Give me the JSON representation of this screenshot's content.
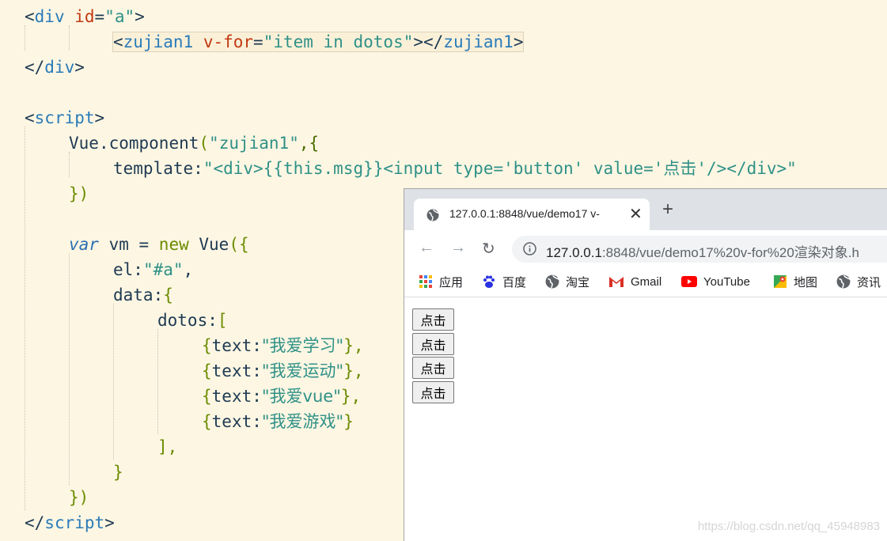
{
  "code": {
    "div_open": {
      "lt": "<",
      "tag": "div",
      "attr": "id",
      "eq": "=",
      "val": "\"a\"",
      "gt": ">"
    },
    "comp_line": {
      "lt": "<",
      "tag": "zujian1",
      "attr": "v-for",
      "eq": "=",
      "val": "\"item in dotos\"",
      "mid": "></",
      "tag2": "zujian1",
      "gt": ">"
    },
    "div_close": {
      "lt": "</",
      "tag": "div",
      "gt": ">"
    },
    "script_open": {
      "lt": "<",
      "tag": "script",
      "gt": ">"
    },
    "vue_component": {
      "obj": "Vue",
      "dot": ".",
      "fn": "component",
      "open": "(",
      "str": "\"zujian1\"",
      "rest": ",{"
    },
    "template_line": {
      "key": "template",
      "colon": ":",
      "str": "\"<div>{{this.msg}}<input type='button' value='点击'/></div>\""
    },
    "comp_close": "})",
    "var_line": {
      "kw": "var",
      "rest": " vm = ",
      "new": "new",
      "ctor": " Vue",
      "open": "({"
    },
    "el_line": {
      "key": "el",
      "colon": ":",
      "str": "\"#a\"",
      "comma": ","
    },
    "data_line": {
      "key": "data",
      "colon": ":",
      "brace": "{"
    },
    "dotos_line": {
      "key": "dotos",
      "colon": ":",
      "bracket": "["
    },
    "items": [
      {
        "open": "{",
        "key": "text",
        "colon": ":",
        "str": "\"我爱学习\"",
        "close": "},"
      },
      {
        "open": "{",
        "key": "text",
        "colon": ":",
        "str": "\"我爱运动\"",
        "close": "},"
      },
      {
        "open": "{",
        "key": "text",
        "colon": ":",
        "str": "\"我爱vue\"",
        "close": "},"
      },
      {
        "open": "{",
        "key": "text",
        "colon": ":",
        "str": "\"我爱游戏\"",
        "close": "}"
      }
    ],
    "bracket_close": "],",
    "brace_close": "}",
    "vm_close": "})",
    "script_close": {
      "lt": "</",
      "tag": "script",
      "gt": ">"
    }
  },
  "browser": {
    "tab_title": "127.0.0.1:8848/vue/demo17 v-",
    "tab_icon": "globe-icon",
    "url_host": "127.0.0.1",
    "url_path": ":8848/vue/demo17%20v-for%20渲染对象.h",
    "bookmarks": [
      "应用",
      "百度",
      "淘宝",
      "Gmail",
      "YouTube",
      "地图",
      "资讯"
    ],
    "buttons": [
      "点击",
      "点击",
      "点击",
      "点击"
    ]
  },
  "watermark": "https://blog.csdn.net/qq_45948983",
  "colors": {
    "editor_bg": "#fdf6e3",
    "tag": "#2a7bb8",
    "attr": "#c23a12",
    "string": "#2f9187",
    "keyword": "#6b8c00"
  }
}
